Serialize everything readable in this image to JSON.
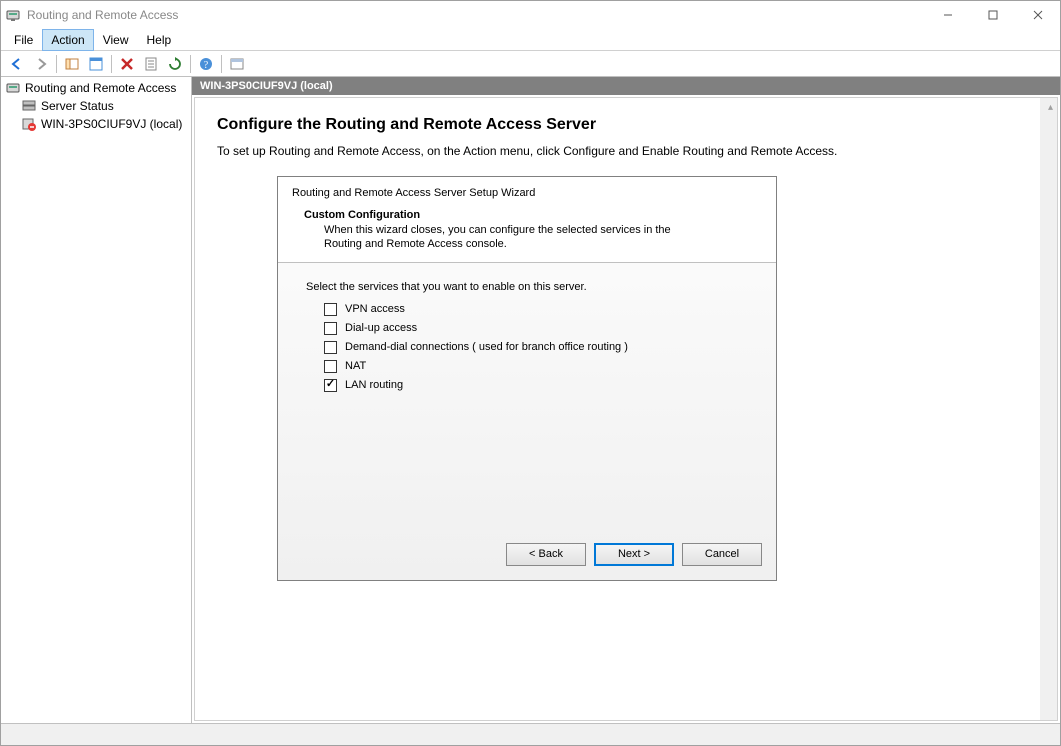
{
  "window": {
    "title": "Routing and Remote Access"
  },
  "menu": {
    "file": "File",
    "action": "Action",
    "view": "View",
    "help": "Help"
  },
  "toolbar": {
    "back": "back-arrow",
    "forward": "forward-arrow",
    "up": "up",
    "props": "properties",
    "delete": "delete",
    "refresh": "refresh",
    "export": "export",
    "help": "help",
    "extra": "extra"
  },
  "tree": {
    "root": "Routing and Remote Access",
    "serverStatus": "Server Status",
    "serverNode": "WIN-3PS0CIUF9VJ (local)"
  },
  "content": {
    "header": "WIN-3PS0CIUF9VJ (local)",
    "h1": "Configure the Routing and Remote Access Server",
    "p1": "To set up Routing and Remote Access, on the Action menu, click Configure and Enable Routing and Remote Access."
  },
  "wizard": {
    "title": "Routing and Remote Access Server Setup Wizard",
    "sub": "Custom Configuration",
    "desc": "When this wizard closes, you can configure the selected services in the Routing and Remote Access console.",
    "prompt": "Select the services that you want to enable on this server.",
    "options": {
      "vpn": {
        "label": "VPN access",
        "checked": false
      },
      "dialup": {
        "label": "Dial-up access",
        "checked": false
      },
      "demand": {
        "label": "Demand-dial connections ( used for branch office routing )",
        "checked": false
      },
      "nat": {
        "label": "NAT",
        "checked": false
      },
      "lan": {
        "label": "LAN routing",
        "checked": true
      }
    },
    "buttons": {
      "back": "< Back",
      "next": "Next >",
      "cancel": "Cancel"
    }
  }
}
